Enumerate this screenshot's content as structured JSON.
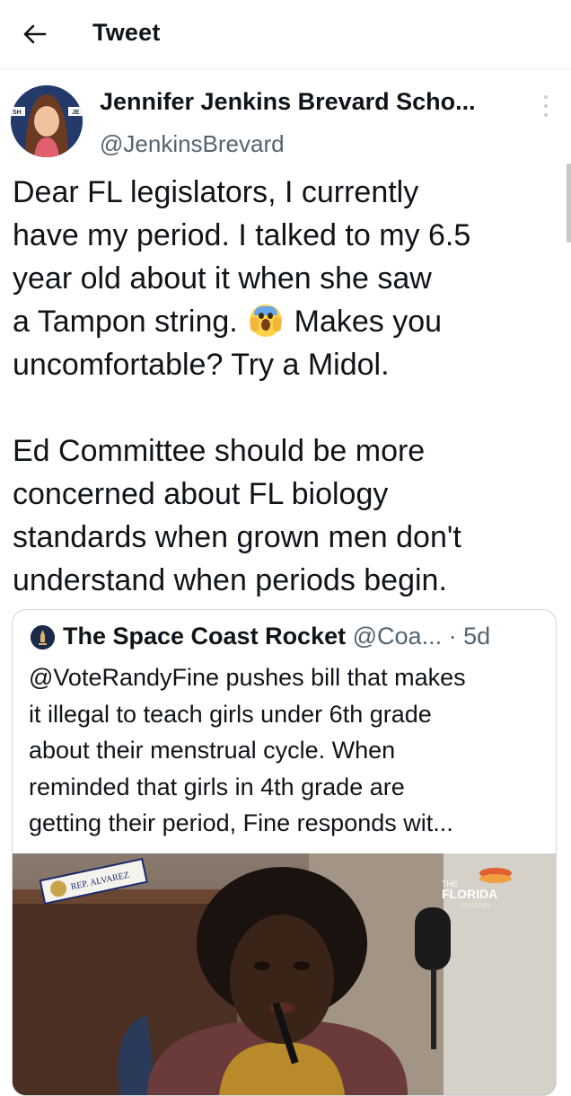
{
  "header": {
    "title": "Tweet",
    "back_icon": "arrow-left-icon"
  },
  "author": {
    "name": "Jennifer Jenkins Brevard Scho...",
    "handle": "@JenkinsBrevard",
    "avatar_badge_left": "SH",
    "avatar_badge_right": "JE"
  },
  "tweet": {
    "lines": [
      "Dear FL legislators, I currently",
      "have my period. I talked to my 6.5",
      "year old about it when she saw",
      "a Tampon string.",
      "Makes you",
      "uncomfortable? Try a Midol.",
      "Ed Committee should be more",
      "concerned about FL biology",
      "standards when grown men don't",
      "understand when periods begin."
    ],
    "emoji": "face-screaming-in-fear-emoji"
  },
  "quoted": {
    "name": "The Space Coast Rocket",
    "handle": "@Coa...",
    "time": "· 5d",
    "lines": [
      "@VoteRandyFine pushes bill that makes",
      "it illegal to teach girls under 6th grade",
      "about their menstrual cycle. When",
      "reminded that girls in 4th grade are",
      "getting their period, Fine responds wit..."
    ],
    "media": {
      "nameplate": "REP. ALVAREZ",
      "channel_top": "THE",
      "channel_name": "FLORIDA",
      "channel_sub": "CHANNEL"
    }
  },
  "colors": {
    "text": "#0f1419",
    "secondary": "#536471",
    "border": "#cfd9de"
  }
}
